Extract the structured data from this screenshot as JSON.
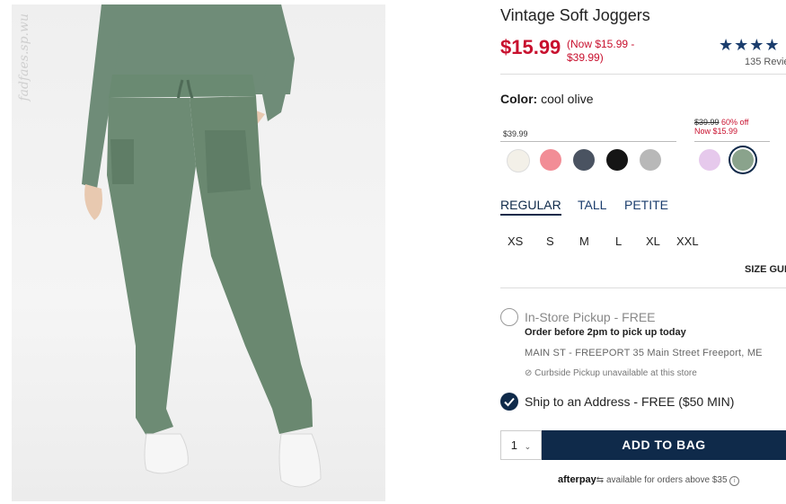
{
  "product": {
    "watermark": "fadfaes.sp.wu",
    "title": "Vintage Soft Joggers",
    "price": "$15.99",
    "price_range": "(Now $15.99 - $39.99)",
    "rating_stars": "★★★★",
    "review_count": "135 Revie"
  },
  "color": {
    "label": "Color:",
    "value": "cool olive",
    "regular_group": {
      "price": "$39.99"
    },
    "sale_group": {
      "was": "$39.99",
      "off": "60% off",
      "now": "Now $15.99"
    },
    "swatches": [
      {
        "hex": "#f3f0e8"
      },
      {
        "hex": "#f28d96"
      },
      {
        "hex": "#4a5361"
      },
      {
        "hex": "#151515"
      },
      {
        "hex": "#b8b8b8"
      },
      {
        "hex": "#e6c9ec"
      },
      {
        "hex": "#8aa38c",
        "selected": true
      }
    ]
  },
  "fits": [
    "REGULAR",
    "TALL",
    "PETITE"
  ],
  "sizes": [
    "XS",
    "S",
    "M",
    "L",
    "XL",
    "XXL"
  ],
  "size_guide": "SIZE GUI",
  "fulfillment": {
    "pickup_title": "In-Store Pickup - FREE",
    "pickup_note": "Order before 2pm to pick up today",
    "store_text": "MAIN ST - FREEPORT 35 Main Street Freeport, ME",
    "curbside": "Curbside Pickup unavailable at this store",
    "ship_title": "Ship to an Address - FREE ($50 MIN)"
  },
  "cart": {
    "qty": "1",
    "add_label": "ADD TO BAG"
  },
  "afterpay": {
    "brand": "afterpay",
    "text": "available for orders above $35"
  },
  "colors": {
    "accent": "#0f2a4a",
    "sale_red": "#c8102e"
  }
}
